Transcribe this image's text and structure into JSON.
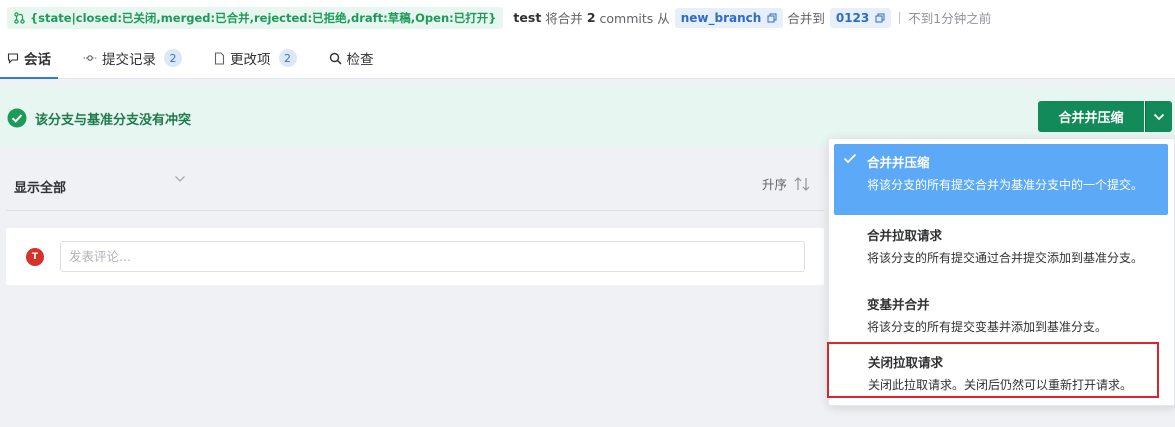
{
  "header": {
    "state_tag": "{state|closed:已关闭,merged:已合并,rejected:已拒绝,draft:草稿,Open:已打开}",
    "author": "test",
    "text_merge": "将合并",
    "commits_count": "2",
    "commits_label": "commits 从",
    "source_branch": "new_branch",
    "text_into": "合并到",
    "target_branch": "0123",
    "time": "不到1分钟之前"
  },
  "tabs": [
    {
      "label": "会话",
      "icon": "chat-icon",
      "active": true
    },
    {
      "label": "提交记录",
      "icon": "commit-icon",
      "count": "2"
    },
    {
      "label": "更改项",
      "icon": "file-icon",
      "count": "2"
    },
    {
      "label": "检查",
      "icon": "search-icon"
    }
  ],
  "merge": {
    "status_text": "该分支与基准分支没有冲突",
    "button_label": "合并并压缩"
  },
  "filter": {
    "label": "显示全部",
    "sort_label": "升序"
  },
  "comment": {
    "avatar_letter": "T",
    "placeholder": "发表评论..."
  },
  "dropdown": {
    "options": [
      {
        "title": "合并并压缩",
        "desc": "将该分支的所有提交合并为基准分支中的一个提交。",
        "selected": true
      },
      {
        "title": "合并拉取请求",
        "desc": "将该分支的所有提交通过合并提交添加到基准分支。"
      },
      {
        "title": "变基并合并",
        "desc": "将该分支的所有提交变基并添加到基准分支。"
      },
      {
        "title": "关闭拉取请求",
        "desc": "关闭此拉取请求。关闭后仍然可以重新打开请求。",
        "highlighted": true
      }
    ]
  },
  "colors": {
    "accent_green": "#138a5a",
    "selected_blue": "#5ca9f7",
    "highlight_red": "#d9252b"
  }
}
